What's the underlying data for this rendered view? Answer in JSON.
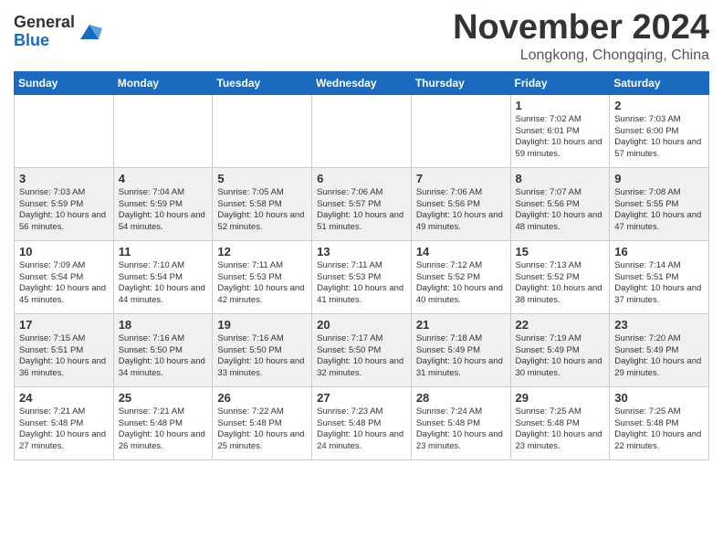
{
  "header": {
    "logo_general": "General",
    "logo_blue": "Blue",
    "month_title": "November 2024",
    "location": "Longkong, Chongqing, China"
  },
  "weekdays": [
    "Sunday",
    "Monday",
    "Tuesday",
    "Wednesday",
    "Thursday",
    "Friday",
    "Saturday"
  ],
  "weeks": [
    [
      {
        "day": "",
        "info": ""
      },
      {
        "day": "",
        "info": ""
      },
      {
        "day": "",
        "info": ""
      },
      {
        "day": "",
        "info": ""
      },
      {
        "day": "",
        "info": ""
      },
      {
        "day": "1",
        "info": "Sunrise: 7:02 AM\nSunset: 6:01 PM\nDaylight: 10 hours and 59 minutes."
      },
      {
        "day": "2",
        "info": "Sunrise: 7:03 AM\nSunset: 6:00 PM\nDaylight: 10 hours and 57 minutes."
      }
    ],
    [
      {
        "day": "3",
        "info": "Sunrise: 7:03 AM\nSunset: 5:59 PM\nDaylight: 10 hours and 56 minutes."
      },
      {
        "day": "4",
        "info": "Sunrise: 7:04 AM\nSunset: 5:59 PM\nDaylight: 10 hours and 54 minutes."
      },
      {
        "day": "5",
        "info": "Sunrise: 7:05 AM\nSunset: 5:58 PM\nDaylight: 10 hours and 52 minutes."
      },
      {
        "day": "6",
        "info": "Sunrise: 7:06 AM\nSunset: 5:57 PM\nDaylight: 10 hours and 51 minutes."
      },
      {
        "day": "7",
        "info": "Sunrise: 7:06 AM\nSunset: 5:56 PM\nDaylight: 10 hours and 49 minutes."
      },
      {
        "day": "8",
        "info": "Sunrise: 7:07 AM\nSunset: 5:56 PM\nDaylight: 10 hours and 48 minutes."
      },
      {
        "day": "9",
        "info": "Sunrise: 7:08 AM\nSunset: 5:55 PM\nDaylight: 10 hours and 47 minutes."
      }
    ],
    [
      {
        "day": "10",
        "info": "Sunrise: 7:09 AM\nSunset: 5:54 PM\nDaylight: 10 hours and 45 minutes."
      },
      {
        "day": "11",
        "info": "Sunrise: 7:10 AM\nSunset: 5:54 PM\nDaylight: 10 hours and 44 minutes."
      },
      {
        "day": "12",
        "info": "Sunrise: 7:11 AM\nSunset: 5:53 PM\nDaylight: 10 hours and 42 minutes."
      },
      {
        "day": "13",
        "info": "Sunrise: 7:11 AM\nSunset: 5:53 PM\nDaylight: 10 hours and 41 minutes."
      },
      {
        "day": "14",
        "info": "Sunrise: 7:12 AM\nSunset: 5:52 PM\nDaylight: 10 hours and 40 minutes."
      },
      {
        "day": "15",
        "info": "Sunrise: 7:13 AM\nSunset: 5:52 PM\nDaylight: 10 hours and 38 minutes."
      },
      {
        "day": "16",
        "info": "Sunrise: 7:14 AM\nSunset: 5:51 PM\nDaylight: 10 hours and 37 minutes."
      }
    ],
    [
      {
        "day": "17",
        "info": "Sunrise: 7:15 AM\nSunset: 5:51 PM\nDaylight: 10 hours and 36 minutes."
      },
      {
        "day": "18",
        "info": "Sunrise: 7:16 AM\nSunset: 5:50 PM\nDaylight: 10 hours and 34 minutes."
      },
      {
        "day": "19",
        "info": "Sunrise: 7:16 AM\nSunset: 5:50 PM\nDaylight: 10 hours and 33 minutes."
      },
      {
        "day": "20",
        "info": "Sunrise: 7:17 AM\nSunset: 5:50 PM\nDaylight: 10 hours and 32 minutes."
      },
      {
        "day": "21",
        "info": "Sunrise: 7:18 AM\nSunset: 5:49 PM\nDaylight: 10 hours and 31 minutes."
      },
      {
        "day": "22",
        "info": "Sunrise: 7:19 AM\nSunset: 5:49 PM\nDaylight: 10 hours and 30 minutes."
      },
      {
        "day": "23",
        "info": "Sunrise: 7:20 AM\nSunset: 5:49 PM\nDaylight: 10 hours and 29 minutes."
      }
    ],
    [
      {
        "day": "24",
        "info": "Sunrise: 7:21 AM\nSunset: 5:48 PM\nDaylight: 10 hours and 27 minutes."
      },
      {
        "day": "25",
        "info": "Sunrise: 7:21 AM\nSunset: 5:48 PM\nDaylight: 10 hours and 26 minutes."
      },
      {
        "day": "26",
        "info": "Sunrise: 7:22 AM\nSunset: 5:48 PM\nDaylight: 10 hours and 25 minutes."
      },
      {
        "day": "27",
        "info": "Sunrise: 7:23 AM\nSunset: 5:48 PM\nDaylight: 10 hours and 24 minutes."
      },
      {
        "day": "28",
        "info": "Sunrise: 7:24 AM\nSunset: 5:48 PM\nDaylight: 10 hours and 23 minutes."
      },
      {
        "day": "29",
        "info": "Sunrise: 7:25 AM\nSunset: 5:48 PM\nDaylight: 10 hours and 23 minutes."
      },
      {
        "day": "30",
        "info": "Sunrise: 7:25 AM\nSunset: 5:48 PM\nDaylight: 10 hours and 22 minutes."
      }
    ]
  ]
}
